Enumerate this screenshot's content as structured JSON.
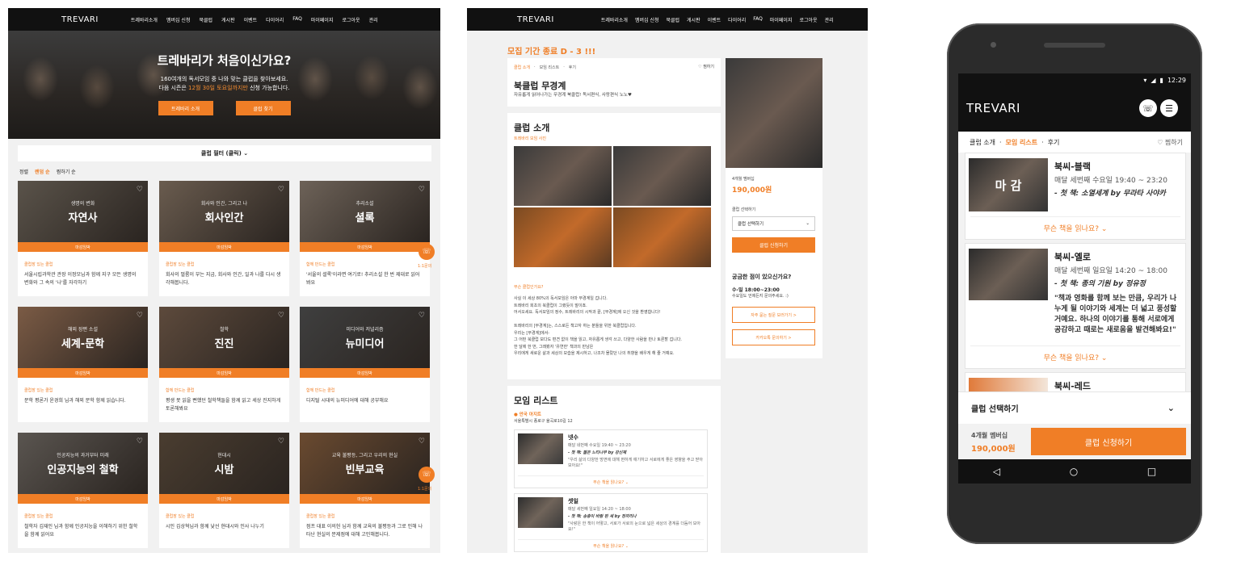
{
  "site": {
    "logo": "TREVARI",
    "nav": [
      "트레바리소개",
      "멤버십 신청",
      "북클럽",
      "게시판",
      "이벤트",
      "다이어리",
      "FAQ",
      "마이페이지",
      "로그아웃",
      "관리"
    ]
  },
  "hero": {
    "title": "트레바리가 처음이신가요?",
    "line1": "160여개의 독서모임 중 나와 맞는 클럽을 찾아보세요.",
    "line2_pre": "다음 시즌은 ",
    "line2_hl": "12월 30일 토요일까지만",
    "line2_post": " 신청 가능합니다.",
    "btn_about": "트레바리 소개",
    "btn_find": "클럽 찾기"
  },
  "filter": {
    "label": "클럽 필터 (클릭)",
    "chev": "⌄"
  },
  "sort": {
    "label": "정렬",
    "options": [
      "랜덤 순",
      "찜하기 순"
    ]
  },
  "cards": [
    {
      "cat": "생명의 변화",
      "title": "자연사",
      "band": "마감임박",
      "tag": "클럽장 있는 클럽",
      "desc": "서울시립과학관 관장 이정모님과 함께 지구 모든 생명의 변화와 그 속의 '나'를 자각하기",
      "color": "#5a534a"
    },
    {
      "cat": "회사와 인간, 그리고 나",
      "title": "회사인간",
      "band": "마감임박",
      "tag": "클럽장 있는 클럽",
      "desc": "회사의 멀룸이 부는 지금, 회사와 인간, 일과 나를 다시 생각해봅니다.",
      "color": "#6a5c4f"
    },
    {
      "cat": "추리소설",
      "title": "셜록",
      "band": "마감임박",
      "tag": "함께 만드는 클럽",
      "desc": "'서울의 셜록'이라면 여기로! 추리소설 한 번 제대로 읽어봐요",
      "color": "#6d6258"
    },
    {
      "cat": "해외 장편 소설",
      "title": "세계-문학",
      "band": "마감임박",
      "tag": "클럽장 있는 클럽",
      "desc": "문학 평론가 윤경희 님과 해외 문학 함께 읽습니다.",
      "color": "#7b5b45"
    },
    {
      "cat": "철학",
      "title": "진진",
      "band": "마감임박",
      "tag": "함께 만드는 클럽",
      "desc": "평생 못 읽을 뻔했던 철학책들을 함께 읽고 세상 진지하게 토론해봐요",
      "color": "#5d4a3c"
    },
    {
      "cat": "미디어와 저널리즘",
      "title": "뉴미디어",
      "band": "마감임박",
      "tag": "함께 만드는 클럽",
      "desc": "디지털 시대의 뉴미디어에 대해 공부해요",
      "color": "#3f3f3f"
    },
    {
      "cat": "인공지능의 과거부터 미래",
      "title": "인공지능의 철학",
      "band": "마감임박",
      "tag": "클럽장 있는 클럽",
      "desc": "철학자 김재인 님과 함께 인공지능을 이해하기 위한 철학을 함께 읽어요",
      "color": "#5a5550"
    },
    {
      "cat": "현대시",
      "title": "시밤",
      "band": "마감임박",
      "tag": "클럽장 있는 클럽",
      "desc": "시인 김상혁님과 함께 낯선 현대시와 인사 나누기",
      "color": "#4a3d30"
    },
    {
      "cat": "교육 불평등, 그리고 우리의 현실",
      "title": "빈부교육",
      "band": "마감임박",
      "tag": "클럽장 있는 클럽",
      "desc": "점프 대표 이의헌 님과 함께 교육의 불평등과 그로 인해 나타난 현실의 문제점에 대해 고민해봅니다.",
      "color": "#6a4a30"
    }
  ],
  "fab": {
    "icon": "☏",
    "label": "1:1문의"
  },
  "detail": {
    "deadline": "모집 기간 종료 D - 3 !!!",
    "crumbs": [
      "클럽 소개",
      "모임 리스트",
      "후기"
    ],
    "wish": "찜하기",
    "title": "북클럽 무경계",
    "subtitle": "자유롭게 읽어나가는 무경계 북클럽! 독서편식, 사랑편식 노노♥",
    "intro_h": "클럽 소개",
    "photo_label": "트레바리 모임 사진",
    "why_h": "무슨 클럽인가요?",
    "body": [
      "사실 이 세상 80%의 독서모임은 아마 무경계일 겁니다.",
      "트레바리 회초의 북클럽이 그랬듯이 말이죠.",
      "어서오세요. 독서모임의 정수, 트레바리의 시작과 끝, [무경계]에 오신 것을 환영합니다!",
      "",
      "트레바리의 [무경계]는, 스스로든 책고자 하는 분들을 위한 북클럽입니다.",
      "우리는 [무경계]에서-",
      "그 어떤 북클럽 보다도 편견 없이 책을 읽고, 자유롭게 생각 쓰고, 다양한 사람을 만나 토론할 겁니다.",
      "한 달에 한 번, 그래봤자 '유연한' 책과의 만남은",
      "우리에게 새로운 삶과 세상의 모습을 제시하고, 나조차 몰랐던 나의 취향을 배우게 해 줄 거예요."
    ],
    "list_h": "모임 리스트",
    "place_name": "안국 아지트",
    "place_addr": "서울특별시 종로구 율곡로10길 12",
    "sessions": [
      {
        "name": "넷수",
        "time": "매달 네번째 수요일 19:40 ~ 23:20",
        "book": "- 첫 책: 젊은 느티나무 by 강신재",
        "quote": "\"우리 삶의 다양한 방면에 대해 편하게 얘기하고 서로에게 좋은 영향을 주고 받아보아요!\"",
        "more": "무슨 책을 읽나요? ⌄"
      },
      {
        "name": "셋일",
        "time": "매달 세번째 일요일 14:20 ~ 18:00",
        "book": "- 첫 책: 송충이 바람 된 새 by 정끼리나",
        "quote": "\"사랑은 한 책이 어떻고, 서로가 서로의 눈으로 넓은 세상의 경계를 더듬어 보아요!\"",
        "more": "무슨 책을 읽나요? ⌄"
      }
    ],
    "membership": "4개월 멤버십",
    "price": "190,000원",
    "select_label": "클럽 선택하기",
    "select_value": "클럽 선택하기",
    "apply": "클럽 신청하기",
    "qa_h": "궁금한 점이 있으신가요?",
    "qa_time": "수-일 18:00~23:00",
    "qa_note": "수요일도 언제든지 문의주세요. :)",
    "qa_btn1": "자주 묻는 질문 보러가기 >",
    "qa_btn2": "카카오톡 문의하기 >"
  },
  "mobile": {
    "time": "12:29",
    "logo": "TREVARI",
    "tabs": [
      "클럽 소개",
      "모임 리스트",
      "후기"
    ],
    "wish": "찜하기",
    "cards": [
      {
        "thumb": "마 감",
        "name": "북씨-블랙",
        "time": "매달 세번째 수요일 19:40 ~ 23:20",
        "book": "- 첫 책: 소열세계 by 무라타 사야카",
        "more": "무슨 책을 읽나요? ⌄"
      },
      {
        "thumb": "",
        "name": "북씨-옐로",
        "time": "매달 세번째 일요일 14:20 ~ 18:00",
        "book": "- 첫 책: 종의 기원 by 정유정",
        "quote": "\"책과 영화를 함께 보는 만큼, 우리가 나누게 될 이야기와 세계는 더 넓고 풍성할거예요. 하나의 이야기를 통해 서로에게 공감하고 때로는 새로움을 발견해봐요!\"",
        "more": "무슨 책을 읽나요? ⌄"
      },
      {
        "name": "북씨-레드"
      }
    ],
    "select": "클럽 선택하기",
    "membership": "4개월 멤버십",
    "price": "190,000원",
    "apply": "클럽 신청하기",
    "nav": [
      "◁",
      "○",
      "□"
    ]
  },
  "colors": {
    "accent": "#f07e26",
    "dark": "#111111"
  }
}
